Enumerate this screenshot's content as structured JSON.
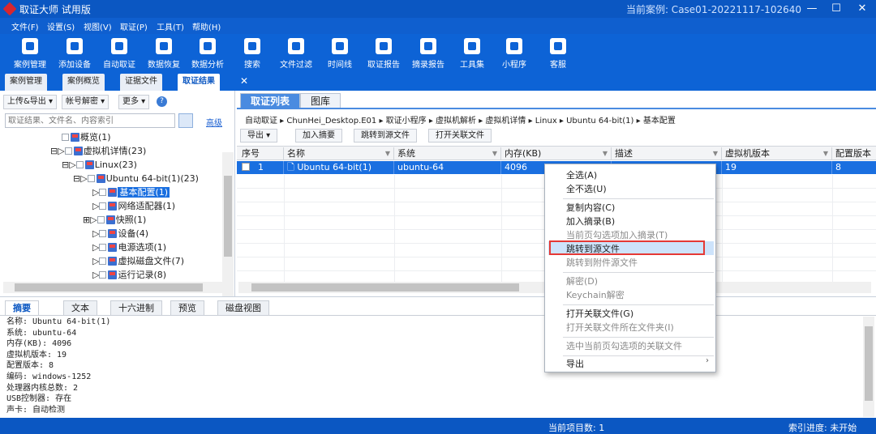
{
  "window": {
    "title": "取证大师 试用版",
    "case_label": "当前案例:  Case01-20221117-102640",
    "min": "—",
    "max": "☐",
    "close": "✕"
  },
  "menu": [
    "文件(F)",
    "设置(S)",
    "视图(V)",
    "取证(P)",
    "工具(T)",
    "帮助(H)"
  ],
  "toolbar": [
    "案例管理",
    "添加设备",
    "自动取证",
    "数据恢复",
    "数据分析",
    "搜索",
    "文件过滤",
    "时间线",
    "取证报告",
    "摘录报告",
    "工具集",
    "小程序",
    "客服"
  ],
  "doc_tabs": [
    "案例管理",
    "案例概览",
    "证据文件",
    "取证结果"
  ],
  "left": {
    "buttons": [
      "上传&导出 ▾",
      "帐号解密 ▾",
      "更多 ▾"
    ],
    "help": "?",
    "search_placeholder": "取证结果、文件名、内容索引",
    "advanced": "高级",
    "tree": [
      "概览(1)",
      "虚拟机详情(23)",
      "Linux(23)",
      "Ubuntu 64-bit(1)(23)",
      "基本配置(1)",
      "网络适配器(1)",
      "快照(1)",
      "设备(4)",
      "电源选项(1)",
      "虚拟磁盘文件(7)",
      "运行记录(8)"
    ]
  },
  "right": {
    "tabs": [
      "取证列表",
      "图库"
    ],
    "breadcrumb": "自动取证 ▸ ChunHei_Desktop.E01 ▸ 取证小程序 ▸ 虚拟机解析 ▸ 虚拟机详情 ▸ Linux ▸ Ubuntu 64-bit(1) ▸ 基本配置",
    "buttons": [
      "导出  ▾",
      "加入摘要",
      "跳转到源文件",
      "打开关联文件"
    ],
    "columns": [
      "序号",
      "名称",
      "系统",
      "内存(KB)",
      "描述",
      "虚拟机版本",
      "配置版本"
    ],
    "row": {
      "index": "1",
      "name": "Ubuntu 64-bit(1)",
      "system": "ubuntu-64",
      "memory": "4096",
      "desc": "",
      "vm_version": "19",
      "config_version": "8"
    }
  },
  "context_menu": [
    "全选(A)",
    "全不选(U)",
    "复制内容(C)",
    "加入摘录(B)",
    "当前页勾选项加入摘录(T)",
    "跳转到源文件",
    "跳转到附件源文件",
    "解密(D)",
    "Keychain解密",
    "打开关联文件(G)",
    "打开关联文件所在文件夹(I)",
    "选中当前页勾选项的关联文件",
    "导出"
  ],
  "bottom": {
    "tabs": [
      "摘要",
      "文本",
      "十六进制",
      "预览",
      "磁盘视图"
    ],
    "summary": [
      "名称: Ubuntu 64-bit(1)",
      "系统: ubuntu-64",
      "内存(KB): 4096",
      "虚拟机版本: 19",
      "配置版本: 8",
      "编码: windows-1252",
      "处理器内核总数: 2",
      "USB控制器: 存在",
      "声卡: 自动检测"
    ]
  },
  "status": {
    "current_count": "当前项目数: 1",
    "index_progress": "索引进度: 未开始"
  }
}
